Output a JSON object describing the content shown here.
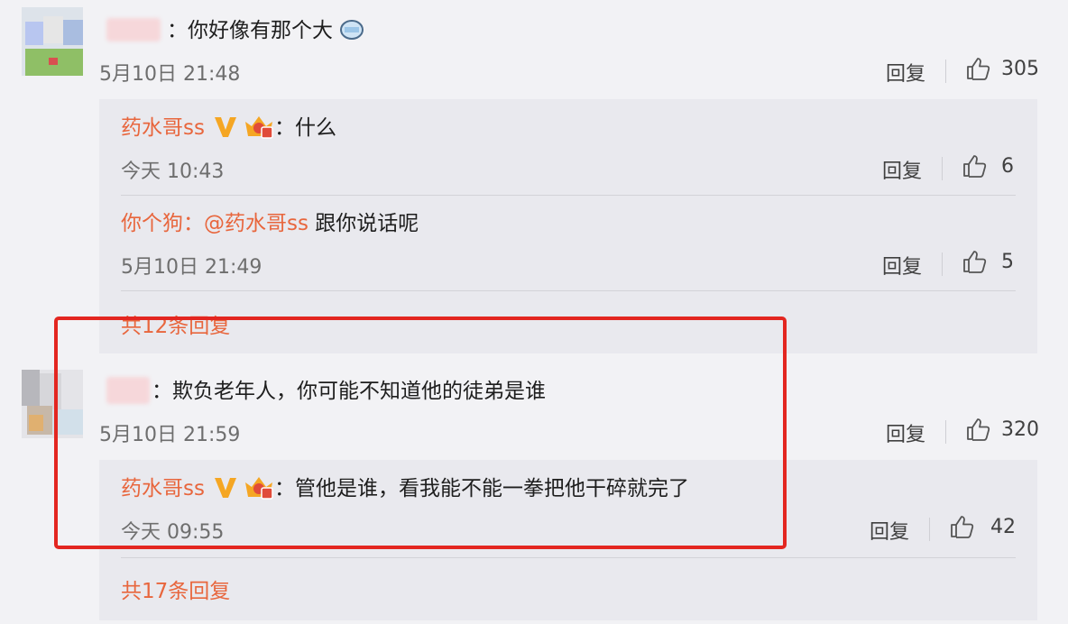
{
  "comments": [
    {
      "text": "：你好像有那个大",
      "time": "5月10日 21:48",
      "reply_label": "回复",
      "likes": "305",
      "replies": [
        {
          "user": "药水哥ss",
          "text": "：什么",
          "time": "今天 10:43",
          "reply_label": "回复",
          "likes": "6"
        },
        {
          "user": "你个狗",
          "mention": "：@药水哥ss",
          "text": " 跟你说话呢",
          "time": "5月10日 21:49",
          "reply_label": "回复",
          "likes": "5"
        }
      ],
      "more_replies": "共12条回复"
    },
    {
      "text": "：欺负老年人，你可能不知道他的徒弟是谁",
      "time": "5月10日 21:59",
      "reply_label": "回复",
      "likes": "320",
      "replies": [
        {
          "user": "药水哥ss",
          "text": "：管他是谁，看我能不能一拳把他干碎就完了",
          "time": "今天 09:55",
          "reply_label": "回复",
          "likes": "42"
        }
      ],
      "more_replies": "共17条回复"
    }
  ],
  "colors": {
    "accent": "#e8663d",
    "highlight": "#e32620",
    "vip": "#f5a623",
    "background": "#f2f2f5",
    "reply_background": "#e9e9ee"
  },
  "icons": [
    "emoji-icon",
    "vip-v-icon",
    "crown-badge-icon",
    "thumbs-up-icon"
  ]
}
